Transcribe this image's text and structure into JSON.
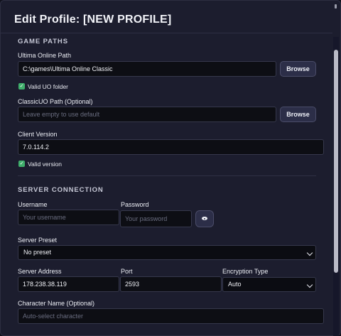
{
  "window": {
    "title": "Edit Profile: [NEW PROFILE]"
  },
  "game_paths": {
    "section_title": "GAME PATHS",
    "uo_path_label": "Ultima Online Path",
    "uo_path_value": "C:\\games\\Ultima Online Classic",
    "browse_label": "Browse",
    "uo_valid_label": "Valid UO folder",
    "classicuo_label": "ClassicUO Path (Optional)",
    "classicuo_placeholder": "Leave empty to use default",
    "client_version_label": "Client Version",
    "client_version_value": "7.0.114.2",
    "version_valid_label": "Valid version"
  },
  "server_connection": {
    "section_title": "SERVER CONNECTION",
    "username_label": "Username",
    "username_placeholder": "Your username",
    "password_label": "Password",
    "password_placeholder": "Your password",
    "server_preset_label": "Server Preset",
    "server_preset_value": "No preset",
    "server_address_label": "Server Address",
    "server_address_value": "178.238.38.119",
    "port_label": "Port",
    "port_value": "2593",
    "encryption_label": "Encryption Type",
    "encryption_value": "Auto",
    "character_label": "Character Name (Optional)",
    "character_placeholder": "Auto-select character"
  },
  "colors": {
    "accent_check": "#3fae6b",
    "background": "#1c1d2e",
    "input_bg": "#0d0e14"
  },
  "icons": {
    "valid": "check-icon",
    "toggle_password": "eye-icon"
  }
}
